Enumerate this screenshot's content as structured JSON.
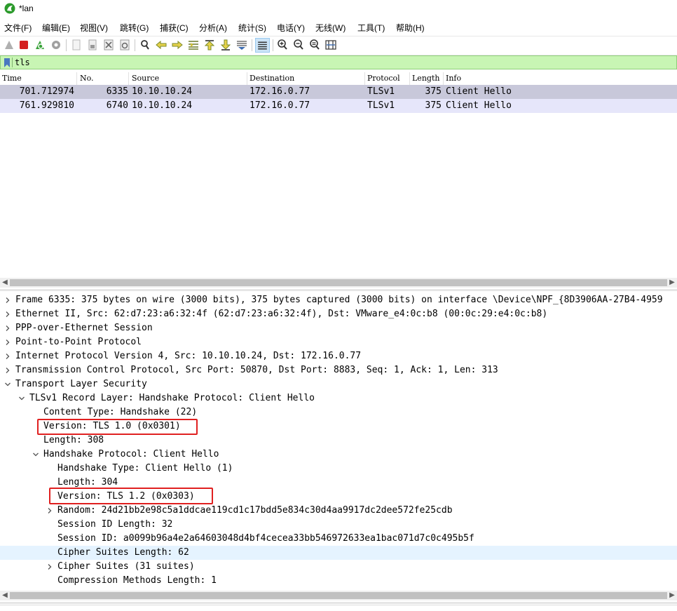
{
  "window": {
    "title": "*lan"
  },
  "menu": [
    "文件(F)",
    "编辑(E)",
    "视图(V)",
    "跳转(G)",
    "捕获(C)",
    "分析(A)",
    "统计(S)",
    "电话(Y)",
    "无线(W)",
    "工具(T)",
    "帮助(H)"
  ],
  "toolbar": {
    "icons": [
      "shark-fin-start-icon",
      "stop-capture-icon",
      "restart-capture-icon",
      "capture-options-icon",
      "open-file-icon",
      "save-file-icon",
      "close-file-icon",
      "reload-file-icon",
      "find-packet-icon",
      "go-back-icon",
      "go-forward-icon",
      "go-to-packet-icon",
      "first-packet-icon",
      "last-packet-icon",
      "autoscroll-icon",
      "colorize-icon",
      "zoom-in-icon",
      "zoom-out-icon",
      "normal-size-icon",
      "resize-columns-icon"
    ]
  },
  "filter": {
    "value": "tls"
  },
  "packet_list": {
    "columns": [
      "Time",
      "No.",
      "Source",
      "Destination",
      "Protocol",
      "Length",
      "Info"
    ],
    "rows": [
      {
        "time": "701.712974",
        "no": "6335",
        "source": "10.10.10.24",
        "destination": "172.16.0.77",
        "protocol": "TLSv1",
        "length": "375",
        "info": "Client Hello",
        "selected": true
      },
      {
        "time": "761.929810",
        "no": "6740",
        "source": "10.10.10.24",
        "destination": "172.16.0.77",
        "protocol": "TLSv1",
        "length": "375",
        "info": "Client Hello",
        "selected": false
      }
    ]
  },
  "details": [
    {
      "text": "Frame 6335: 375 bytes on wire (3000 bits), 375 bytes captured (3000 bits) on interface \\Device\\NPF_{8D3906AA-27B4-4959",
      "state": "collapsed"
    },
    {
      "text": "Ethernet II, Src: 62:d7:23:a6:32:4f (62:d7:23:a6:32:4f), Dst: VMware_e4:0c:b8 (00:0c:29:e4:0c:b8)",
      "state": "collapsed"
    },
    {
      "text": "PPP-over-Ethernet Session",
      "state": "collapsed"
    },
    {
      "text": "Point-to-Point Protocol",
      "state": "collapsed"
    },
    {
      "text": "Internet Protocol Version 4, Src: 10.10.10.24, Dst: 172.16.0.77",
      "state": "collapsed"
    },
    {
      "text": "Transmission Control Protocol, Src Port: 50870, Dst Port: 8883, Seq: 1, Ack: 1, Len: 313",
      "state": "collapsed"
    },
    {
      "text": "Transport Layer Security",
      "state": "expanded"
    },
    {
      "text": "TLSv1 Record Layer: Handshake Protocol: Client Hello",
      "state": "expanded"
    },
    {
      "text": "Content Type: Handshake (22)",
      "state": "leaf"
    },
    {
      "text": "Version: TLS 1.0 (0x0301)",
      "state": "leaf",
      "boxed": true
    },
    {
      "text": "Length: 308",
      "state": "leaf"
    },
    {
      "text": "Handshake Protocol: Client Hello",
      "state": "expanded"
    },
    {
      "text": "Handshake Type: Client Hello (1)",
      "state": "leaf"
    },
    {
      "text": "Length: 304",
      "state": "leaf"
    },
    {
      "text": "Version: TLS 1.2 (0x0303)",
      "state": "leaf",
      "boxed": true
    },
    {
      "text": "Random: 24d21bb2e98c5a1ddcae119cd1c17bdd5e834c30d4aa9917dc2dee572fe25cdb",
      "state": "collapsed"
    },
    {
      "text": "Session ID Length: 32",
      "state": "leaf"
    },
    {
      "text": "Session ID: a0099b96a4e2a64603048d4bf4cecea33bb546972633ea1bac071d7c0c495b5f",
      "state": "leaf"
    },
    {
      "text": "Cipher Suites Length: 62",
      "state": "leaf",
      "highlighted": true
    },
    {
      "text": "Cipher Suites (31 suites)",
      "state": "collapsed"
    },
    {
      "text": "Compression Methods Length: 1",
      "state": "leaf"
    }
  ],
  "colors": {
    "selected_row": "#c8c8da",
    "second_row": "#e6e6fa",
    "filter_ok": "#c8f5b4",
    "annotation_box": "#e02020",
    "tree_highlight": "#e5f3ff"
  }
}
